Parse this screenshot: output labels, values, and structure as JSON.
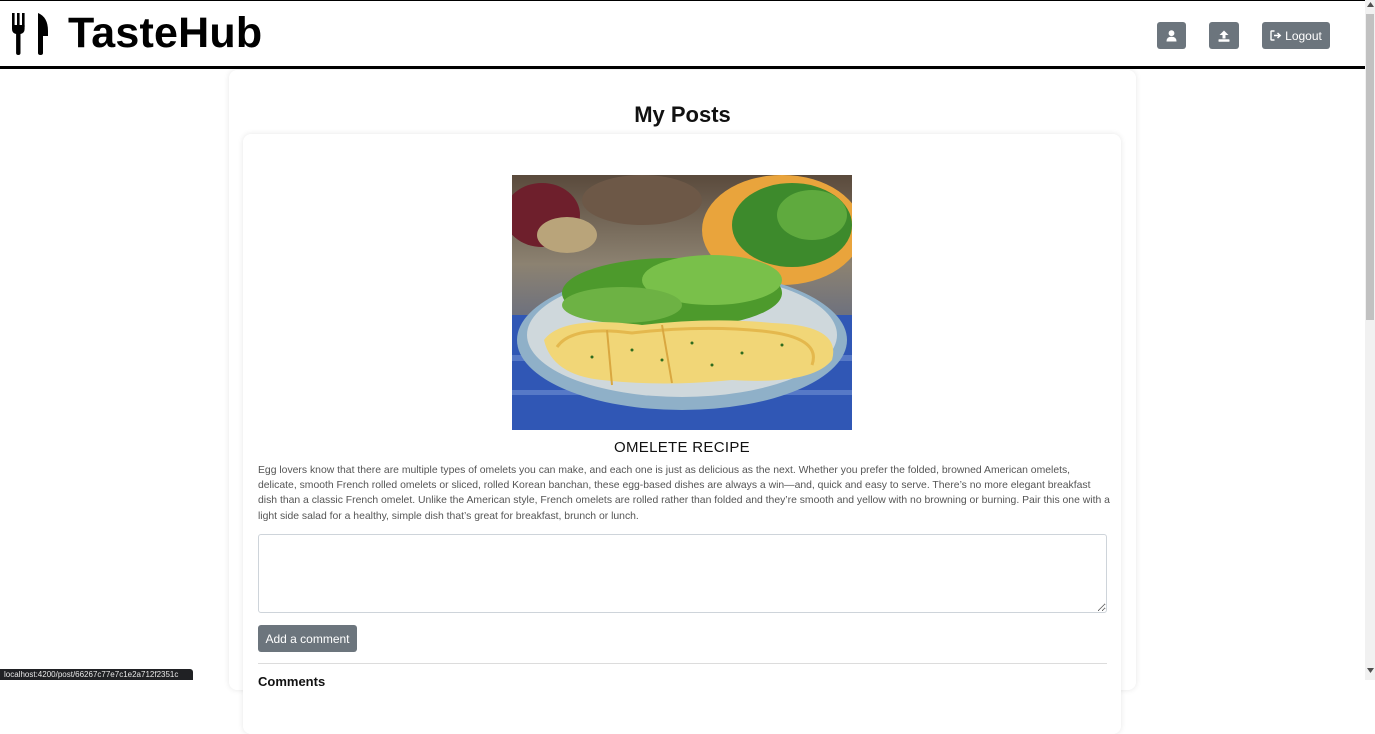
{
  "header": {
    "brand": "TasteHub",
    "logout_label": "Logout"
  },
  "icons": {
    "brand": "fork-knife-icon",
    "profile": "user-icon",
    "upload": "upload-icon",
    "logout": "sign-out-icon"
  },
  "main": {
    "title": "My Posts",
    "post": {
      "title": "OMELETE RECIPE",
      "description": "Egg lovers know that there are multiple types of omelets you can make, and each one is just as delicious as the next. Whether you prefer the folded, browned American omelets, delicate, smooth French rolled omelets or sliced, rolled Korean banchan, these egg-based dishes are always a win—and, quick and easy to serve. There’s no more elegant breakfast dish than a classic French omelet. Unlike the American style, French omelets are rolled rather than folded and they’re smooth and yellow with no browning or burning. Pair this one with a light side salad for a healthy, simple dish that’s great for breakfast, brunch or lunch.",
      "comment_value": "",
      "add_comment_label": "Add a comment",
      "comments_heading": "Comments"
    }
  },
  "status_bar": {
    "url": "localhost:4200/post/66267c77e7c1e2a712f2351c"
  },
  "colors": {
    "button": "#6c757d",
    "border": "#000000"
  }
}
